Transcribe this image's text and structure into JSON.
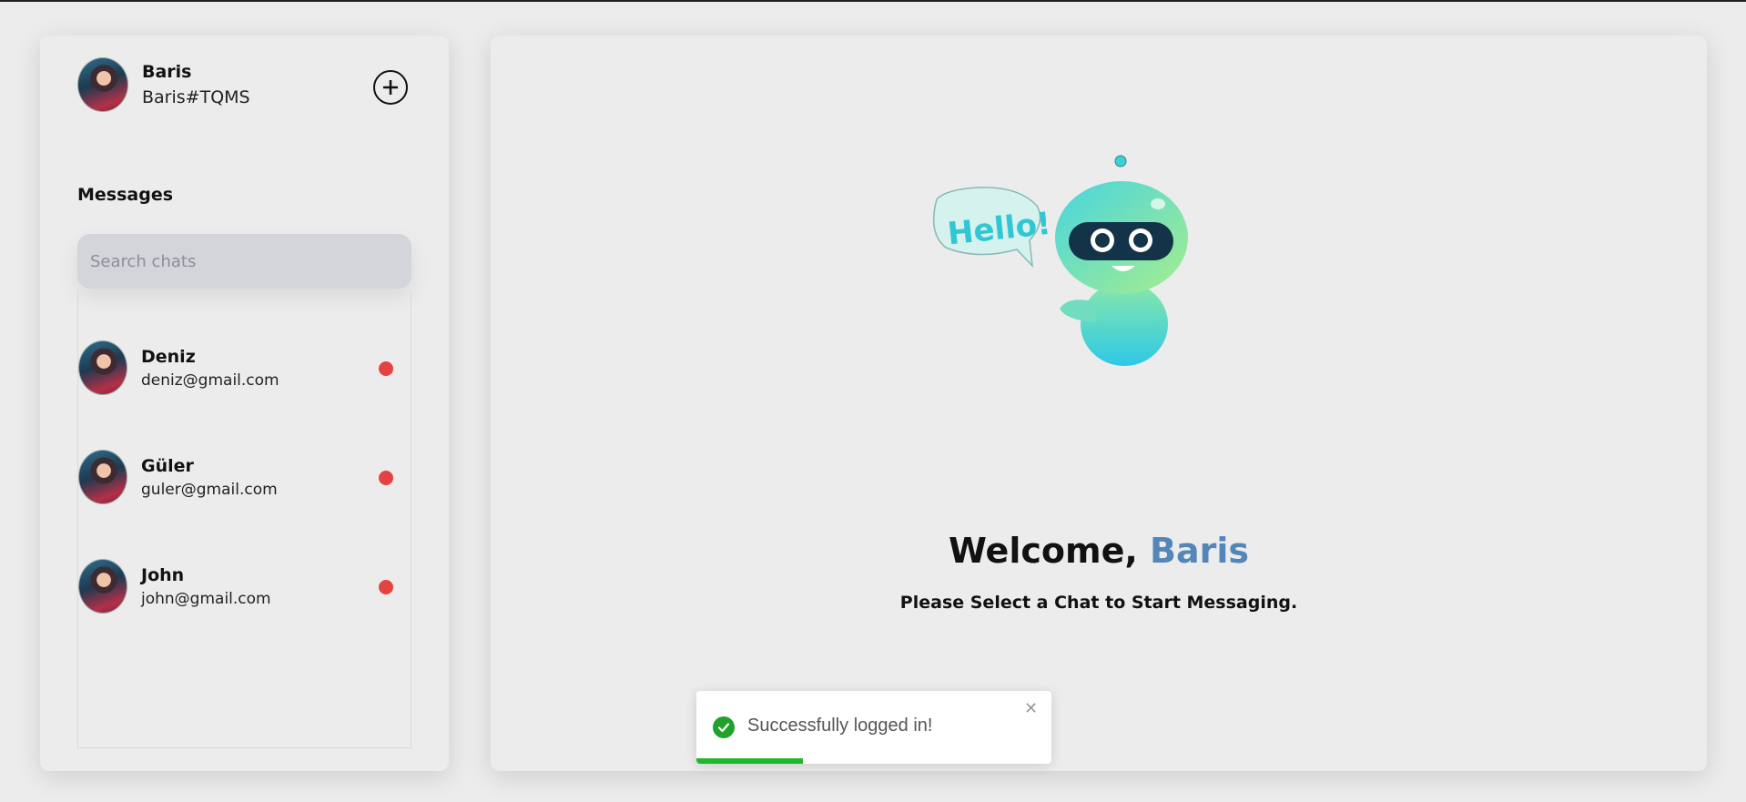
{
  "user": {
    "name": "Baris",
    "tag": "Baris#TQMS"
  },
  "sidebar": {
    "add_icon": "plus-circle-icon",
    "messages_title": "Messages",
    "search_placeholder": "Search chats",
    "chats": [
      {
        "name": "Deniz",
        "email": "deniz@gmail.com",
        "status_color": "#e54343"
      },
      {
        "name": "Güler",
        "email": "guler@gmail.com",
        "status_color": "#e54343"
      },
      {
        "name": "John",
        "email": "john@gmail.com",
        "status_color": "#e54343"
      }
    ]
  },
  "main": {
    "illustration_text": "Hello!",
    "welcome_prefix": "Welcome, ",
    "welcome_name": "Baris",
    "accent_color": "#5486b9",
    "subtitle": "Please Select a Chat to Start Messaging."
  },
  "toast": {
    "message": "Successfully logged in!",
    "icon": "check-circle-icon",
    "close_label": "✕",
    "progress_fraction": 0.3,
    "color": "#1fb82c"
  }
}
